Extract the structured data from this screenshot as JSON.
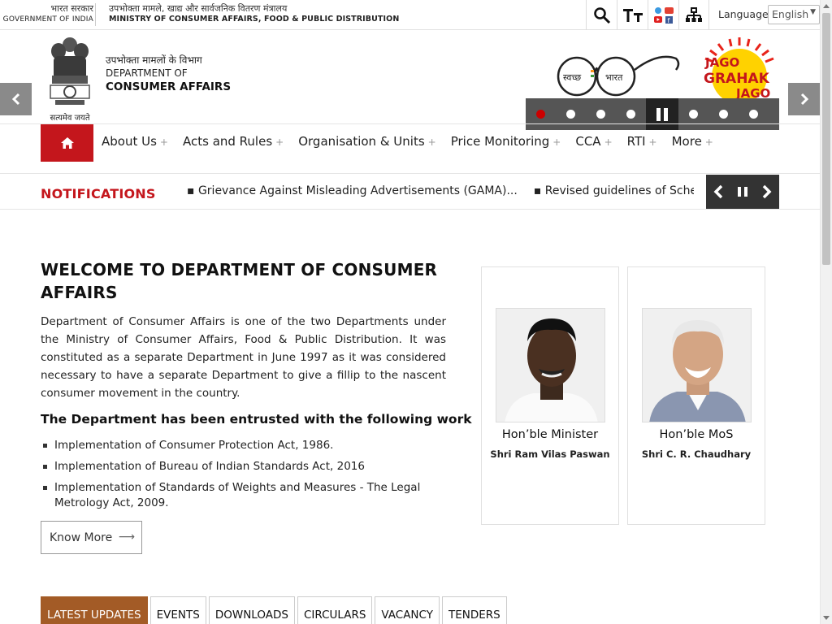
{
  "topbar": {
    "gov_hi": "भारत सरकार",
    "gov_en": "GOVERNMENT OF INDIA",
    "ministry_hi": "उपभोक्ता मामले, खाद्य और सार्वजनिक वितरण मंत्रालय",
    "ministry_en": "MINISTRY OF CONSUMER AFFAIRS, FOOD & PUBLIC DISTRIBUTION",
    "tools": [
      "search-icon",
      "text-size-icon",
      "social-icon",
      "sitemap-icon"
    ],
    "language_label": "Language",
    "language_value": "English"
  },
  "header": {
    "emblem_motto": "सत्यमेव जयते",
    "dept_hi": "उपभोक्ता मामलों के विभाग",
    "dept_line1": "DEPARTMENT OF",
    "dept_line2": "CONSUMER AFFAIRS",
    "swachh_left": "स्वच्छ",
    "swachh_right": "भारत",
    "jago_line1": "JAGO",
    "jago_line2": "GRAHAK",
    "jago_line3": "JAGO",
    "slider_count": 8,
    "slider_active": 1
  },
  "nav": {
    "items": [
      {
        "label": "About Us"
      },
      {
        "label": "Acts and Rules"
      },
      {
        "label": "Organisation & Units"
      },
      {
        "label": "Price Monitoring"
      },
      {
        "label": "CCA"
      },
      {
        "label": "RTI"
      },
      {
        "label": "More"
      }
    ]
  },
  "notifications": {
    "title": "NOTIFICATIONS",
    "items": [
      "Grievance Against Misleading Advertisements (GAMA)...",
      "Revised guidelines of Scheme for S"
    ]
  },
  "welcome": {
    "heading": "WELCOME TO DEPARTMENT OF CONSUMER AFFAIRS",
    "body": "Department of Consumer Affairs is one of the two Departments under the Ministry of Consumer Affairs, Food & Public Distribution. It was constituted as a separate Department in June 1997 as it was considered necessary to have a separate Department to give a fillip to the nascent consumer movement in the country.",
    "work_heading": "The Department has been entrusted with the following work",
    "work_items": [
      "Implementation of Consumer Protection Act, 1986.",
      "Implementation of Bureau of Indian Standards Act, 2016",
      "Implementation of Standards of Weights and Measures - The Legal Metrology Act, 2009."
    ],
    "know_more": "Know More"
  },
  "ministers": [
    {
      "role": "Hon’ble Minister",
      "name": "Shri Ram Vilas Paswan"
    },
    {
      "role": "Hon’ble MoS",
      "name": "Shri C. R. Chaudhary"
    }
  ],
  "tabs": [
    "LATEST UPDATES",
    "EVENTS",
    "DOWNLOADS",
    "CIRCULARS",
    "VACANCY",
    "TENDERS"
  ],
  "colors": {
    "brand_red": "#c4161c",
    "tab_active": "#a35b26",
    "slider_bg": "#555555"
  }
}
